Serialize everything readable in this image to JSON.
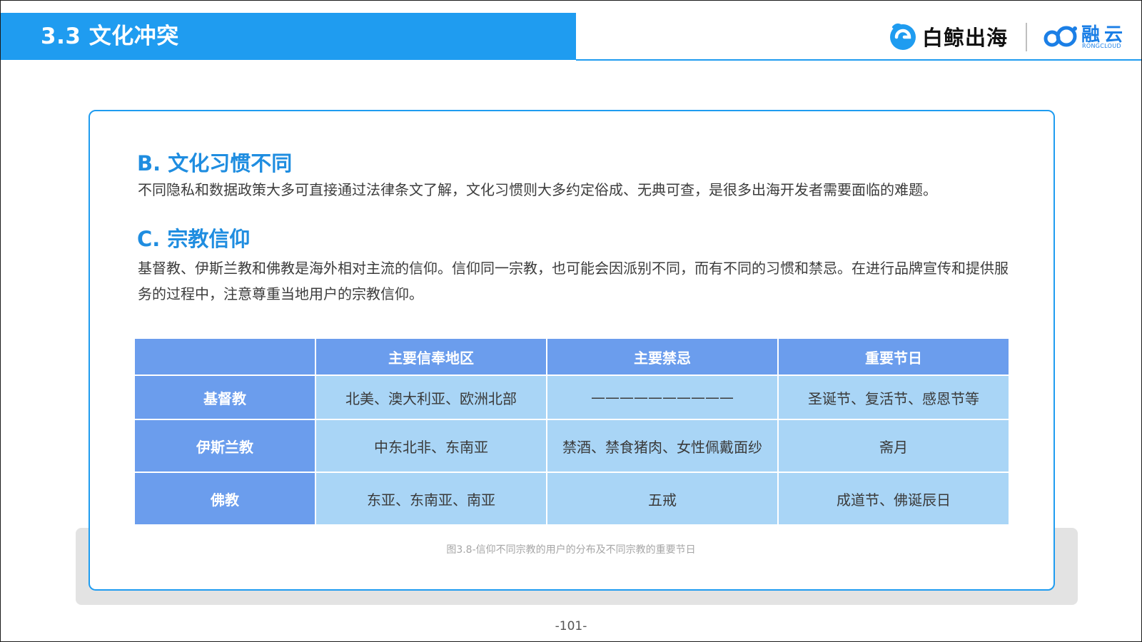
{
  "header": {
    "title": "3.3 文化冲突",
    "logo_baijing": "白鲸出海",
    "logo_rongcloud": "融云",
    "logo_rongcloud_sub": "RONGCLOUD"
  },
  "sections": [
    {
      "heading": "B. 文化习惯不同",
      "body": "不同隐私和数据政策大多可直接通过法律条文了解，文化习惯则大多约定俗成、无典可查，是很多出海开发者需要面临的难题。"
    },
    {
      "heading": "C. 宗教信仰",
      "body": "基督教、伊斯兰教和佛教是海外相对主流的信仰。信仰同一宗教，也可能会因派别不同，而有不同的习惯和禁忌。在进行品牌宣传和提供服务的过程中，注意尊重当地用户的宗教信仰。"
    }
  ],
  "table": {
    "headers": [
      "",
      "主要信奉地区",
      "主要禁忌",
      "重要节日"
    ],
    "rows": [
      {
        "religion": "基督教",
        "regions": "北美、澳大利亚、欧洲北部",
        "taboos": "——————————",
        "festivals": "圣诞节、复活节、感恩节等"
      },
      {
        "religion": "伊斯兰教",
        "regions": "中东北非、东南亚",
        "taboos": "禁酒、禁食猪肉、女性佩戴面纱",
        "festivals": "斋月"
      },
      {
        "religion": "佛教",
        "regions": "东亚、东南亚、南亚",
        "taboos": "五戒",
        "festivals": "成道节、佛诞辰日"
      }
    ]
  },
  "caption": "图3.8-信仰不同宗教的用户的分布及不同宗教的重要节日",
  "page_number": "-101-",
  "colors": {
    "accent_blue": "#1f9cf0",
    "table_header": "#6b9ded",
    "table_cell": "#a9d5f6"
  },
  "icons": [
    "baijing-logo-icon",
    "rongcloud-logo-icon"
  ]
}
